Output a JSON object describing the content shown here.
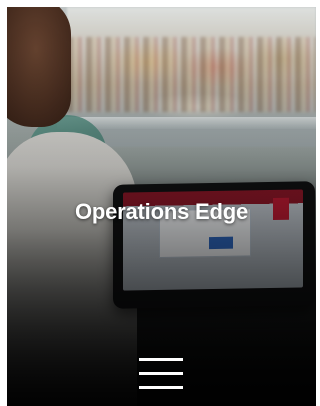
{
  "hero": {
    "title": "Operations Edge"
  },
  "menu": {
    "icon": "hamburger-menu-icon"
  },
  "colors": {
    "title_text": "#ffffff",
    "menu_icon": "#ffffff",
    "pos_accent_red": "#a0172a",
    "pos_button_blue": "#2c63b8"
  }
}
